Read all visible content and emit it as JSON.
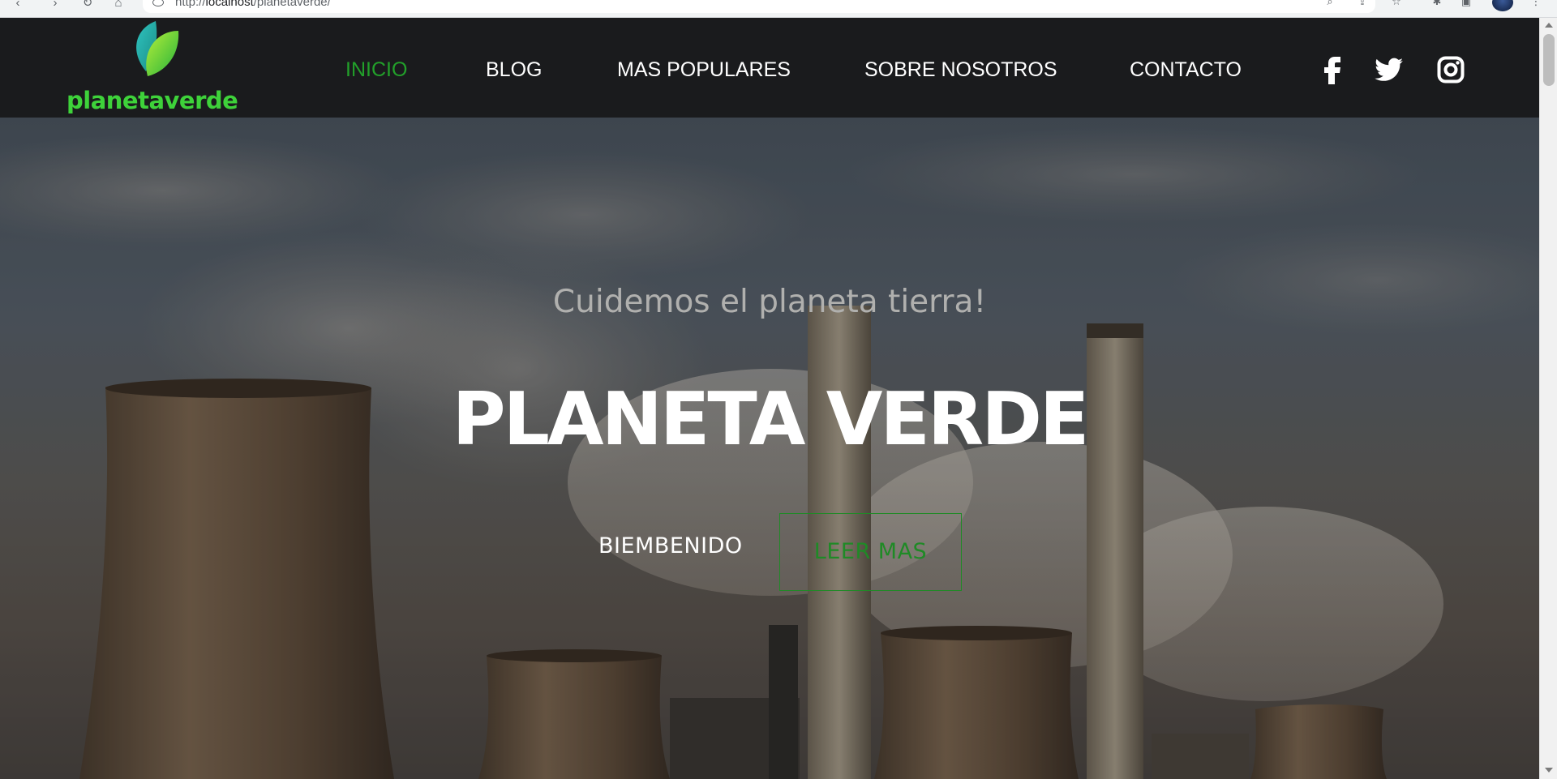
{
  "browser": {
    "url_prefix": "http://",
    "url_host": "localhost",
    "url_path": "/planetaverde/"
  },
  "header": {
    "brand": "planetaverde",
    "nav": [
      {
        "label": "INICIO",
        "active": true
      },
      {
        "label": "BLOG"
      },
      {
        "label": "MAS POPULARES"
      },
      {
        "label": "SOBRE NOSOTROS"
      },
      {
        "label": "CONTACTO"
      }
    ],
    "social_icons": [
      "facebook-icon",
      "twitter-icon",
      "instagram-icon"
    ],
    "colors": {
      "background": "#1a1b1d",
      "active": "#22a02a",
      "brand": "#3ed23a"
    }
  },
  "hero": {
    "subtitle": "Cuidemos el planeta tierra!",
    "title": "PLANETA VERDE",
    "welcome": "BIEMBENIDO",
    "button": "LEER MAS",
    "colors": {
      "button": "#1f8a26",
      "title": "#ffffff"
    }
  }
}
